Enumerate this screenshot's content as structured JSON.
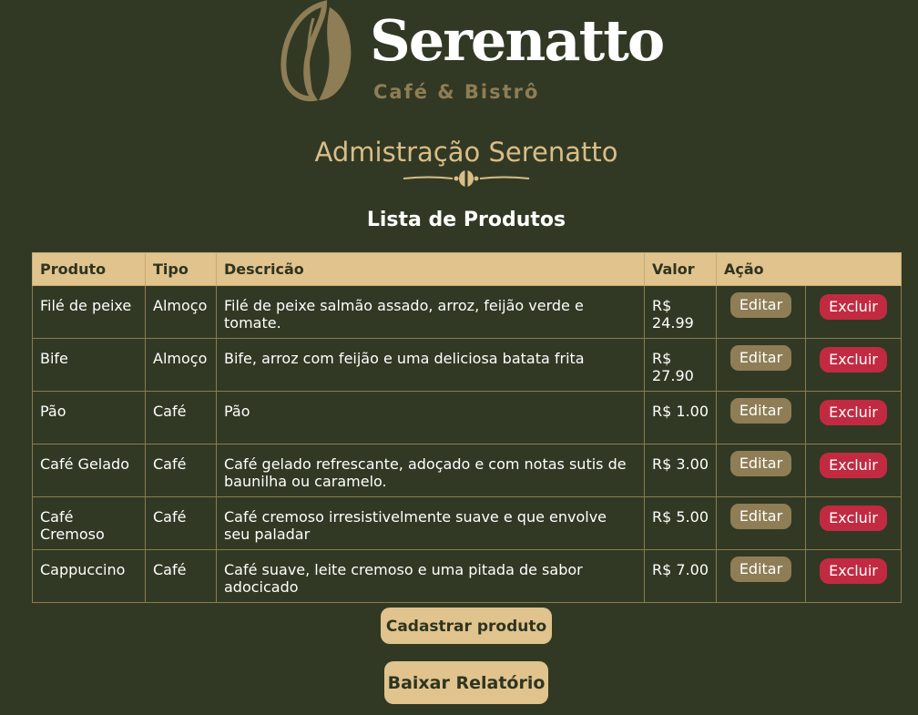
{
  "brand": {
    "name": "Serenatto",
    "subtitle": "Café & Bistrô"
  },
  "admin_title": "Admistração Serenatto",
  "list_title": "Lista de Produtos",
  "table": {
    "headers": [
      "Produto",
      "Tipo",
      "Descricão",
      "Valor",
      "Ação"
    ],
    "rows": [
      {
        "produto": "Filé de peixe",
        "tipo": "Almoço",
        "descricao": "Filé de peixe salmão assado, arroz, feijão verde e tomate.",
        "valor": "R$ 24.99"
      },
      {
        "produto": "Bife",
        "tipo": "Almoço",
        "descricao": "Bife, arroz com feijão e uma deliciosa batata frita",
        "valor": "R$ 27.90"
      },
      {
        "produto": "Pão",
        "tipo": "Café",
        "descricao": "Pão",
        "valor": "R$ 1.00"
      },
      {
        "produto": "Café Gelado",
        "tipo": "Café",
        "descricao": "Café gelado refrescante, adoçado e com notas sutis de baunilha ou caramelo.",
        "valor": "R$ 3.00"
      },
      {
        "produto": "Café Cremoso",
        "tipo": "Café",
        "descricao": "Café cremoso irresistivelmente suave e que envolve seu paladar",
        "valor": "R$ 5.00"
      },
      {
        "produto": "Cappuccino",
        "tipo": "Café",
        "descricao": "Café suave, leite cremoso e uma pitada de sabor adocicado",
        "valor": "R$ 7.00"
      }
    ],
    "edit_label": "Editar",
    "delete_label": "Excluir"
  },
  "buttons": {
    "register": "Cadastrar produto",
    "report": "Baixar Relatório"
  },
  "colors": {
    "background": "#313924",
    "accent": "#e0c38d",
    "edit": "#8e7d55",
    "delete": "#c22a41"
  }
}
